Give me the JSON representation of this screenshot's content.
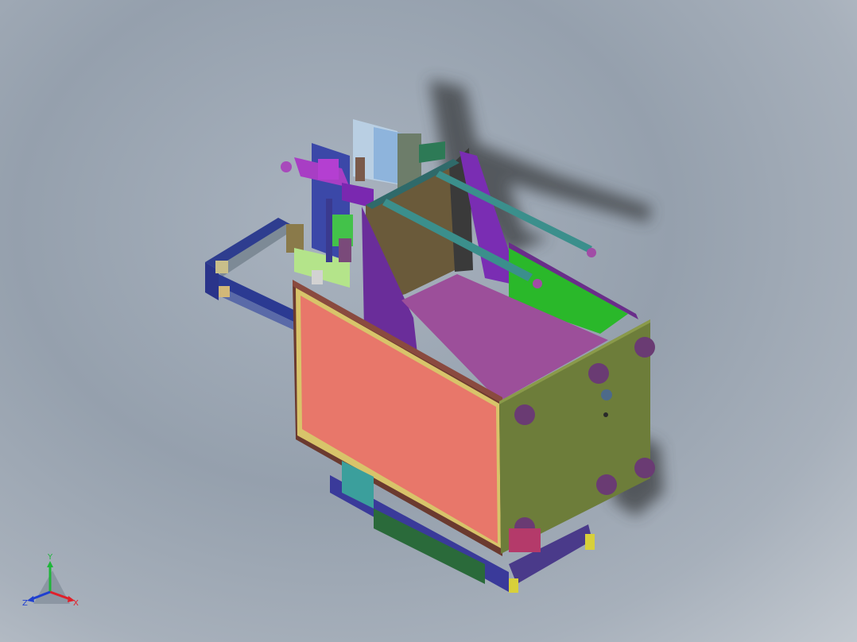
{
  "view": {
    "triad": {
      "x_label": "X",
      "y_label": "Y",
      "z_label": "Z"
    },
    "colors": {
      "background": "#9aa5b1",
      "front_panel": "#e8776a",
      "side_panel": "#6d7d3a",
      "top_face": "#9c4f9a",
      "gusset": "#7a2db3",
      "rail": "#3b8f8c",
      "frame": "#3e4fa0",
      "foot": "#6a3b73",
      "green_deck": "#2ab82a",
      "axis_x": "#e0202a",
      "axis_y": "#1fb53a",
      "axis_z": "#1f3fd0"
    }
  }
}
